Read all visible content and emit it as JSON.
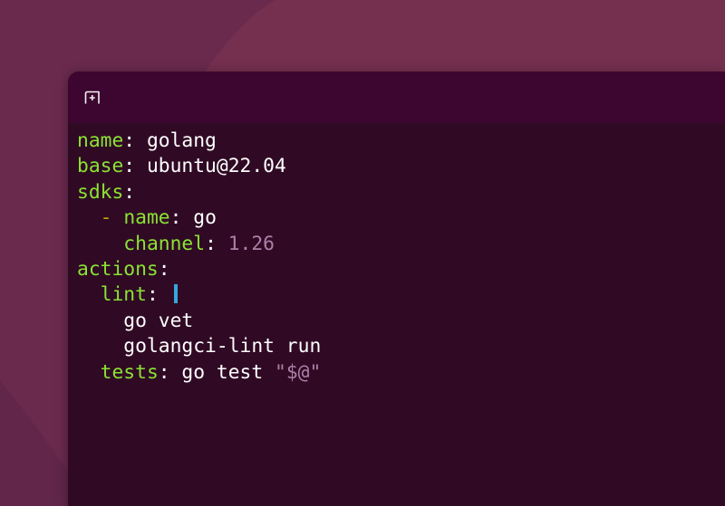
{
  "theme": {
    "wallpaper_color": "#6a2a4e",
    "headerbar_color": "#3c0630",
    "terminal_bg": "#300a24",
    "key_color": "#8ae234",
    "dash_color": "#c4a000",
    "value_color": "#ffffff",
    "literal_color": "#ad7fa8",
    "cursor_color": "#34a6e0"
  },
  "headerbar": {
    "new_tab_icon": "new-tab-icon"
  },
  "editor": {
    "lines": [
      {
        "indent": "",
        "key": "name",
        "sep": ":",
        "value": " golang"
      },
      {
        "indent": "",
        "key": "base",
        "sep": ":",
        "value": " ubuntu@22.04"
      },
      {
        "indent": "",
        "key": "sdks",
        "sep": ":"
      },
      {
        "indent": "  ",
        "dash": "-",
        "key": "name",
        "sep": ":",
        "value": " go"
      },
      {
        "indent": "    ",
        "key": "channel",
        "sep": ":",
        "literal": " 1.26"
      },
      {
        "indent": "",
        "key": "actions",
        "sep": ":"
      },
      {
        "indent": "  ",
        "key": "lint",
        "sep": ": ",
        "pipe": "|"
      },
      {
        "indent": "    ",
        "value": "go vet"
      },
      {
        "indent": "    ",
        "value": "golangci-lint run"
      },
      {
        "indent": "  ",
        "key": "tests",
        "sep": ":",
        "value": " go test ",
        "literal": "\"$@\""
      }
    ]
  }
}
